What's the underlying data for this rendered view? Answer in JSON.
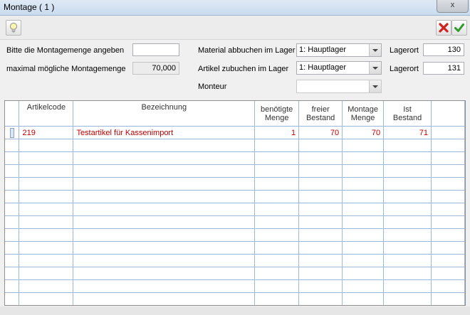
{
  "window": {
    "title": "Montage ( 1 )",
    "close_glyph": "x"
  },
  "toolbar": {
    "left_icon": "lightbulb-icon",
    "cancel_icon": "red-x-icon",
    "ok_icon": "green-check-icon"
  },
  "form": {
    "montagemenge_label": "Bitte die Montagemenge angeben",
    "montagemenge_value": "",
    "max_label": "maximal mögliche Montagemenge",
    "max_value": "70,000",
    "material_label": "Material abbuchen im Lager",
    "material_value": "1: Hauptlager",
    "artikel_label": "Artikel zubuchen im Lager",
    "artikel_value": "1: Hauptlager",
    "monteur_label": "Monteur",
    "monteur_value": "",
    "lagerort1_label": "Lagerort",
    "lagerort1_value": "130",
    "lagerort2_label": "Lagerort",
    "lagerort2_value": "131"
  },
  "grid": {
    "headers": {
      "artikelcode": "Artikelcode",
      "bezeichnung": "Bezeichnung",
      "benoetigte": [
        "benötigte",
        "Menge"
      ],
      "freier": [
        "freier",
        "Bestand"
      ],
      "montage": [
        "Montage",
        "Menge"
      ],
      "ist": [
        "Ist",
        "Bestand"
      ]
    },
    "rows": [
      {
        "artikelcode": "219",
        "bezeichnung": "Testartikel für Kassenimport",
        "benoetigte": "1",
        "freier": "70",
        "montage": "70",
        "ist": "71"
      }
    ],
    "empty_rows": 13
  }
}
